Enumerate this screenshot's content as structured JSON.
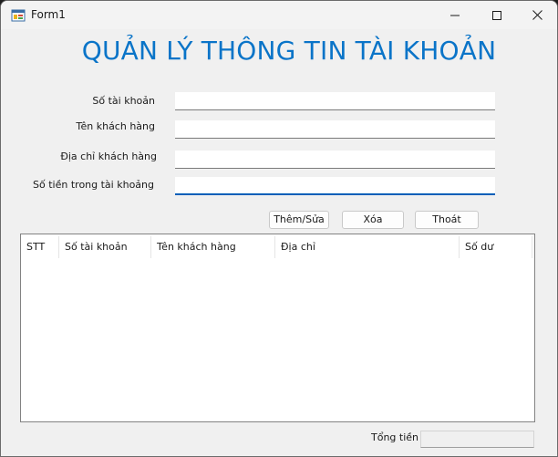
{
  "window": {
    "title": "Form1",
    "icon": "winforms-app-icon",
    "controls": [
      "minimize-icon",
      "maximize-icon",
      "close-icon"
    ]
  },
  "form": {
    "heading": "QUẢN LÝ THÔNG TIN TÀI KHOẢN",
    "heading_color": "#0a74c8",
    "fields": [
      {
        "label": "Số tài khoản",
        "value": ""
      },
      {
        "label": "Tên khách hàng",
        "value": ""
      },
      {
        "label": "Địa chỉ khách hàng",
        "value": ""
      },
      {
        "label": "Số tiền trong tài khoảng",
        "value": ""
      }
    ],
    "focused_field_accent": "#005fb8",
    "buttons": {
      "add_edit": "Thêm/Sửa",
      "delete": "Xóa",
      "exit": "Thoát"
    }
  },
  "listview": {
    "columns": [
      "STT",
      "Số tài khoản",
      "Tên khách hàng",
      "Địa chỉ",
      "Số dư"
    ],
    "rows": []
  },
  "total": {
    "label": "Tổng tiền",
    "value": ""
  }
}
